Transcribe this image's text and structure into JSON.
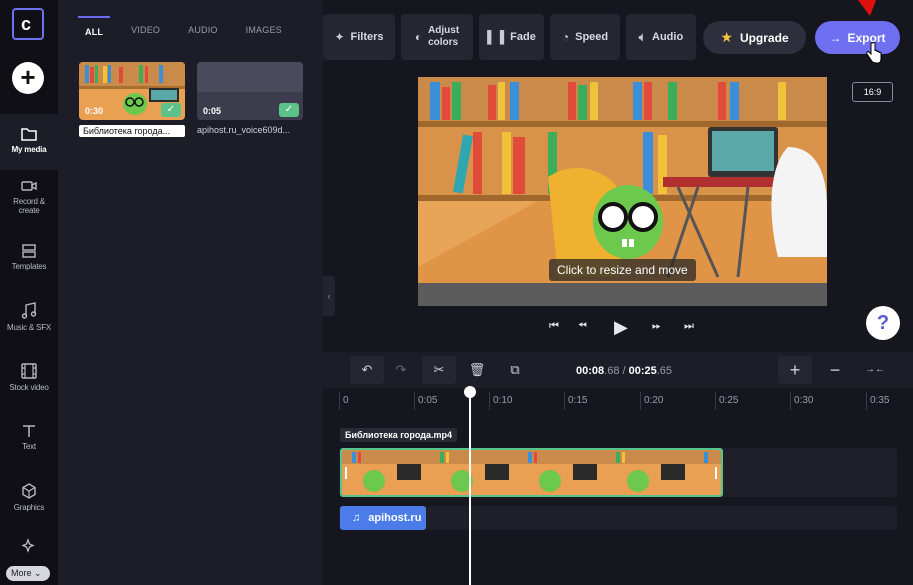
{
  "rail": {
    "items": [
      {
        "label": "My media",
        "icon": "folder-icon"
      },
      {
        "label": "Record &\ncreate",
        "icon": "camera-icon"
      },
      {
        "label": "Templates",
        "icon": "templates-icon"
      },
      {
        "label": "Music & SFX",
        "icon": "music-icon"
      },
      {
        "label": "Stock video",
        "icon": "film-icon"
      },
      {
        "label": "Text",
        "icon": "text-icon"
      },
      {
        "label": "Graphics",
        "icon": "graphics-icon"
      }
    ],
    "more_label": "More"
  },
  "media": {
    "tabs": [
      "ALL",
      "VIDEO",
      "AUDIO",
      "IMAGES"
    ],
    "items": [
      {
        "duration": "0:30",
        "name": "Библиотека города..."
      },
      {
        "duration": "0:05",
        "name": "apihost.ru_voice609d..."
      }
    ]
  },
  "toolbar": {
    "filters": "Filters",
    "adjust_colors": "Adjust\ncolors",
    "fade": "Fade",
    "speed": "Speed",
    "audio": "Audio",
    "upgrade": "Upgrade",
    "export": "Export",
    "ratio": "16:9"
  },
  "preview": {
    "hint": "Click to resize and move"
  },
  "timeline": {
    "current": "00:08",
    "current_frac": ".68",
    "total": "00:25",
    "total_frac": ".65",
    "ticks": [
      "0",
      "0:05",
      "0:10",
      "0:15",
      "0:20",
      "0:25",
      "0:30",
      "0:35"
    ],
    "video_clip_label": "Библиотека города.mp4",
    "audio_clip_label": "apihost.ru"
  },
  "colors": {
    "accent": "#6f6ff2",
    "clip_border": "#57c48c",
    "audio_clip": "#4b7cea"
  }
}
